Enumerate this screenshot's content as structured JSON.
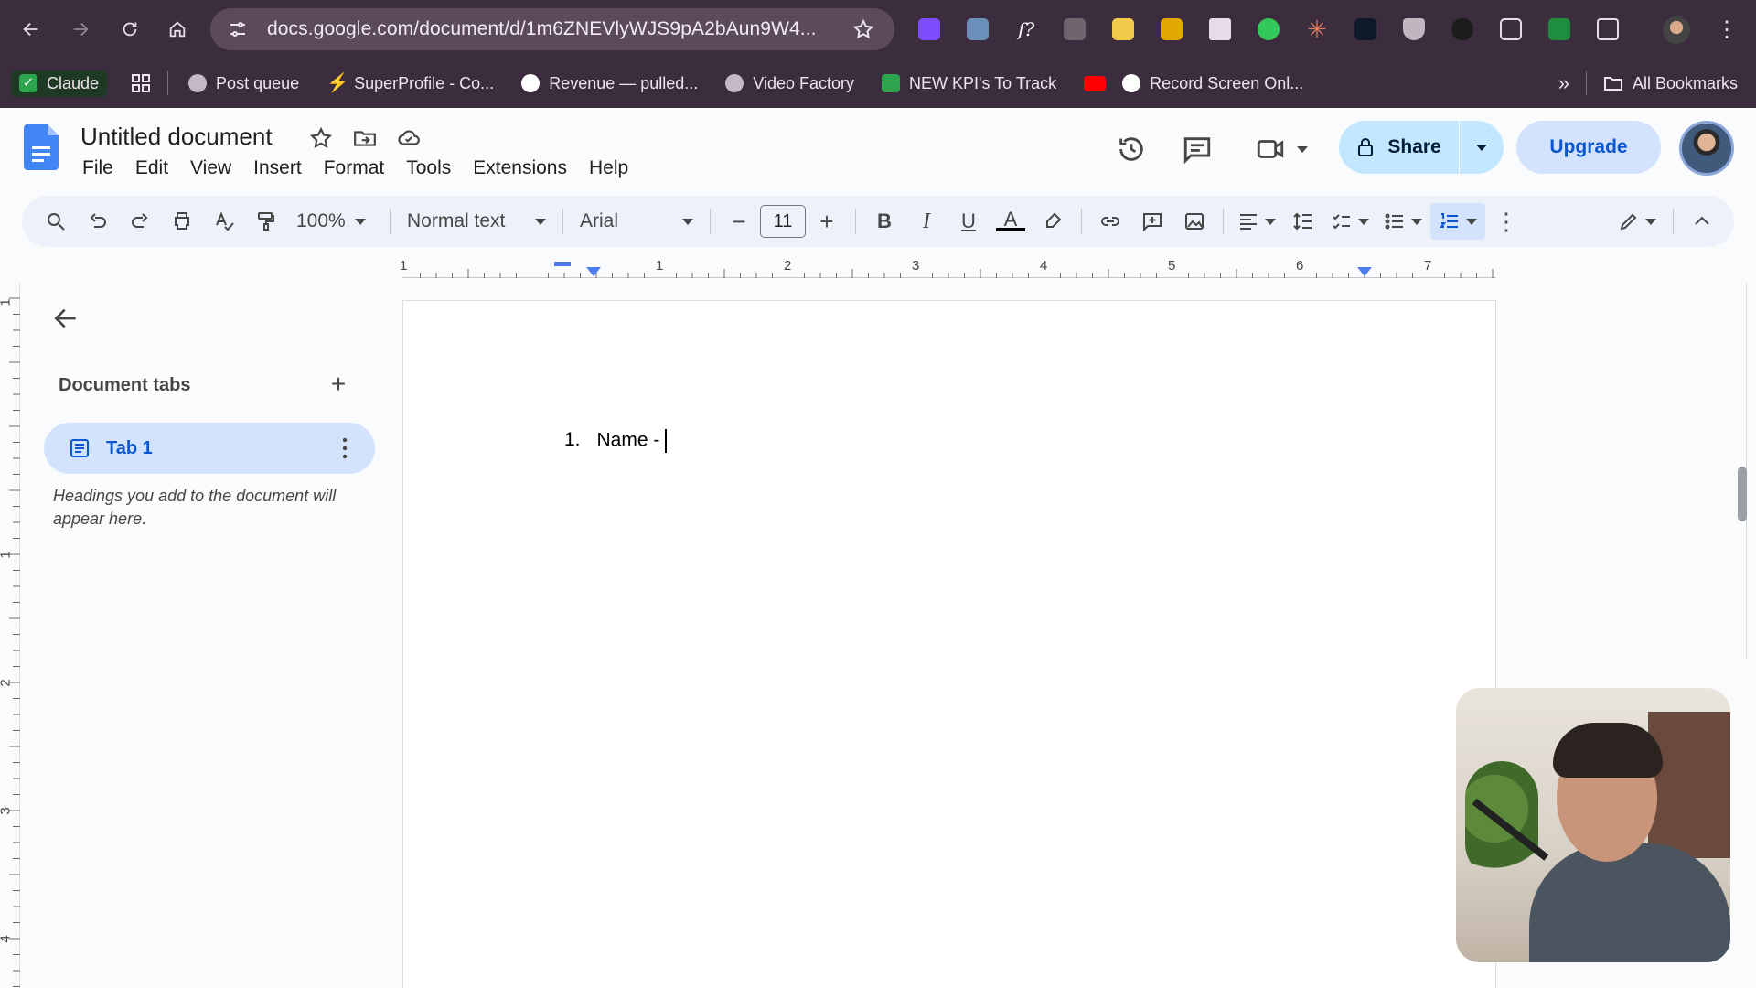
{
  "browser": {
    "url": "docs.google.com/document/d/1m6ZNEVlyWJS9pA2bAun9W4...",
    "extension_icons": [
      "d-extension-icon",
      "image-extension-icon",
      "fx-extension-icon",
      "camera-extension-icon",
      "chart-extension-icon",
      "folder-extension-icon",
      "printer-extension-icon",
      "eye-extension-icon",
      "asterisk-extension-icon",
      "bracket-extension-icon",
      "shield-extension-icon",
      "eye-off-extension-icon",
      "robot-extension-icon",
      "sheet-extension-icon",
      "puzzle-extension-icon"
    ]
  },
  "bookmarks": {
    "items": [
      {
        "label": "Claude",
        "icon": "claude-check-icon",
        "color": "#2da44e"
      },
      {
        "label": "Post queue",
        "icon": "globe-icon",
        "color": "#c4b8c5"
      },
      {
        "label": "SuperProfile - Co...",
        "icon": "bolt-icon",
        "color": "#4a7cf0"
      },
      {
        "label": "Revenue — pulled...",
        "icon": "triangle-icon",
        "color": "#ffffff"
      },
      {
        "label": "Video Factory",
        "icon": "globe-icon",
        "color": "#c4b8c5"
      },
      {
        "label": "NEW KPI's To Track",
        "icon": "sheets-icon",
        "color": "#2da44e"
      },
      {
        "label": "",
        "icon": "youtube-icon",
        "color": "#ff0000"
      },
      {
        "label": "Record Screen Onl...",
        "icon": "triangle-icon",
        "color": "#ffffff"
      }
    ],
    "more": "»",
    "all_bookmarks": "All Bookmarks"
  },
  "doc": {
    "title": "Untitled document",
    "menu": [
      "File",
      "Edit",
      "View",
      "Insert",
      "Format",
      "Tools",
      "Extensions",
      "Help"
    ],
    "share_label": "Share",
    "upgrade_label": "Upgrade"
  },
  "toolbar": {
    "zoom": "100%",
    "style": "Normal text",
    "font": "Arial",
    "font_size": "11"
  },
  "ruler": {
    "labels": [
      "1",
      "1",
      "2",
      "3",
      "4",
      "5",
      "6",
      "7"
    ],
    "vertical_labels": [
      "1",
      "1",
      "2",
      "3",
      "4"
    ]
  },
  "sidebar": {
    "heading": "Document tabs",
    "add": "+",
    "tab_label": "Tab 1",
    "hint": "Headings you add to the document will appear here."
  },
  "content": {
    "list_number": "1.",
    "list_text": "Name -"
  },
  "colors": {
    "chrome_bg": "#3c2d3e",
    "accent": "#0b57d0",
    "share_bg": "#c2e7ff",
    "tab_bg": "#d3e3fd"
  }
}
